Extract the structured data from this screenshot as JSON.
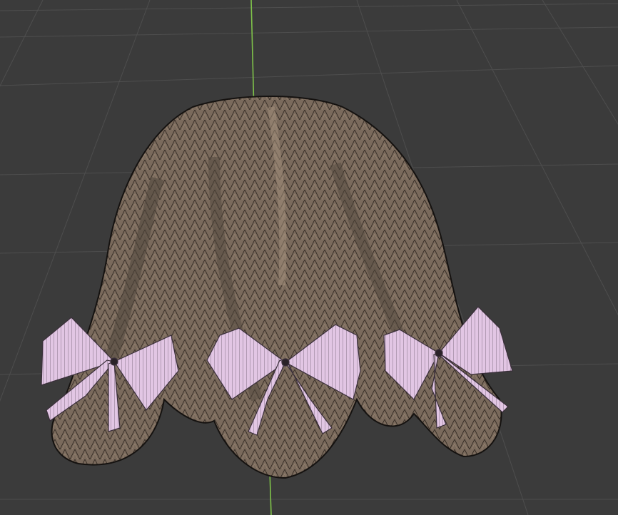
{
  "viewport": {
    "background": "#3b3b3b",
    "grid_color": "#4e4e4e",
    "y_axis_color": "#7fc24a"
  },
  "model": {
    "hair_fill": "#7a6a5c",
    "hair_shadow": "#4f453c",
    "hair_edge": "#151210",
    "bow_fill": "#e2c6e4",
    "bow_edge": "#3a2f3a",
    "bow_count": 3
  }
}
